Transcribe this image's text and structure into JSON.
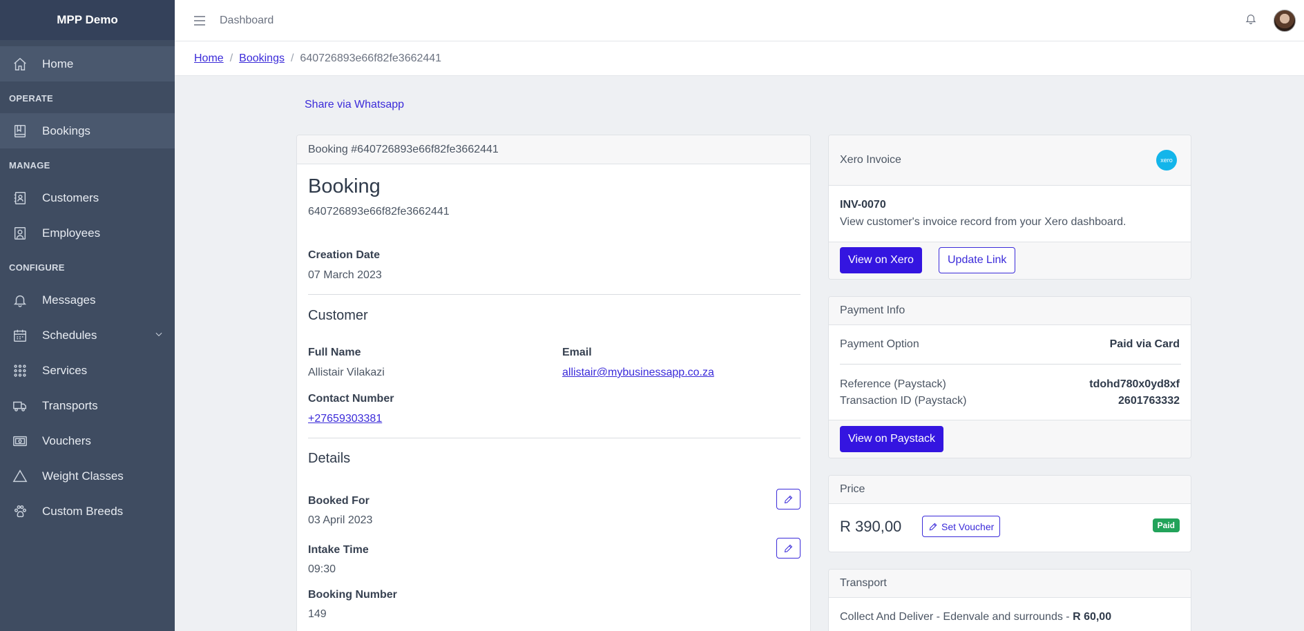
{
  "app": {
    "brand": "MPP Demo",
    "page_title": "Dashboard"
  },
  "sidebar": {
    "home": "Home",
    "sections": {
      "operate": "OPERATE",
      "manage": "MANAGE",
      "configure": "CONFIGURE"
    },
    "items": {
      "bookings": "Bookings",
      "customers": "Customers",
      "employees": "Employees",
      "messages": "Messages",
      "schedules": "Schedules",
      "services": "Services",
      "transports": "Transports",
      "vouchers": "Vouchers",
      "weight_classes": "Weight Classes",
      "custom_breeds": "Custom Breeds"
    }
  },
  "breadcrumb": {
    "home": "Home",
    "bookings": "Bookings",
    "current": "640726893e66f82fe3662441"
  },
  "share_label": "Share via Whatsapp",
  "booking": {
    "header": "Booking #640726893e66f82fe3662441",
    "title": "Booking",
    "id": "640726893e66f82fe3662441",
    "creation_date_label": "Creation Date",
    "creation_date": "07 March 2023",
    "customer_heading": "Customer",
    "full_name_label": "Full Name",
    "full_name": "Allistair Vilakazi",
    "email_label": "Email",
    "email": "allistair@mybusinessapp.co.za",
    "contact_label": "Contact Number",
    "contact": "+27659303381",
    "details_heading": "Details",
    "booked_for_label": "Booked For",
    "booked_for": "03 April 2023",
    "intake_label": "Intake Time",
    "intake": "09:30",
    "booking_number_label": "Booking Number",
    "booking_number": "149"
  },
  "xero": {
    "header": "Xero Invoice",
    "logo_text": "xero",
    "invoice": "INV-0070",
    "description": "View customer's invoice record from your Xero dashboard.",
    "view_label": "View on Xero",
    "update_label": "Update Link"
  },
  "payment": {
    "header": "Payment Info",
    "option_label": "Payment Option",
    "option_value": "Paid via Card",
    "reference_label": "Reference (Paystack)",
    "reference_value": "tdohd780x0yd8xf",
    "transaction_label": "Transaction ID (Paystack)",
    "transaction_value": "2601763332",
    "view_label": "View on Paystack"
  },
  "price": {
    "header": "Price",
    "amount": "R 390,00",
    "voucher_label": "Set Voucher",
    "status": "Paid"
  },
  "transport": {
    "header": "Transport",
    "description": "Collect And Deliver - Edenvale and surrounds - ",
    "amount": "R 60,00"
  },
  "colors": {
    "primary": "#3415e0",
    "sidebar": "#3f4c61",
    "paid_badge": "#22a35a",
    "xero": "#13b5ea"
  }
}
